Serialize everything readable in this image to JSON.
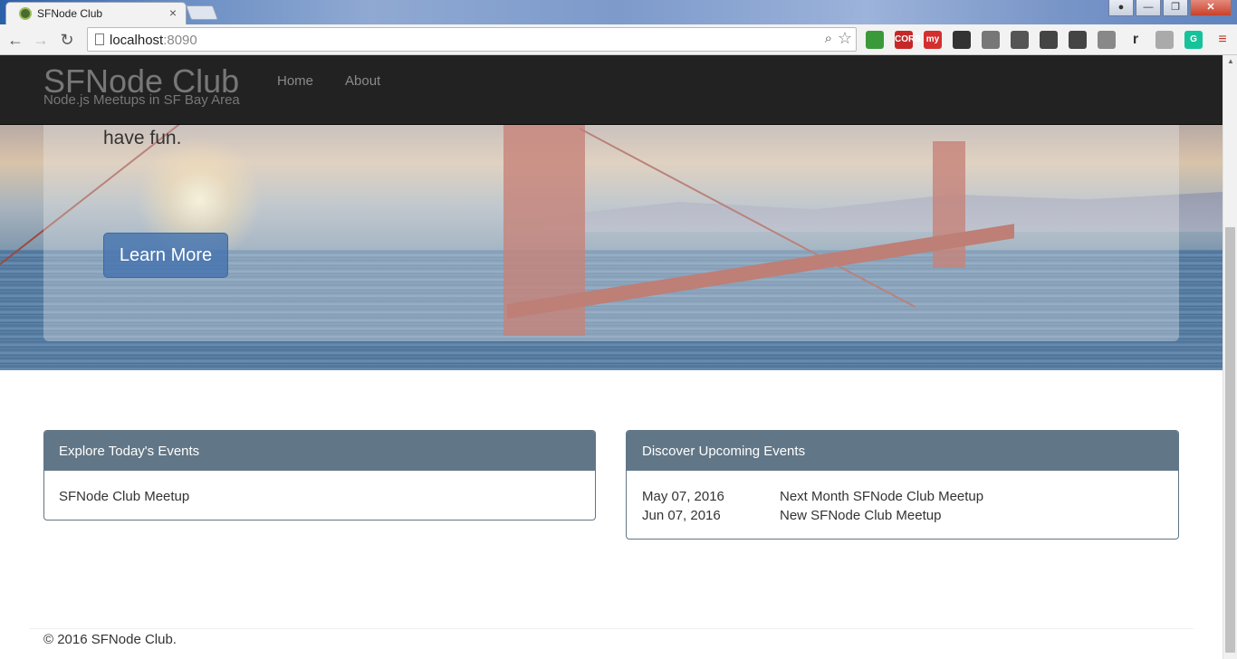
{
  "browser": {
    "tab_title": "SFNode Club",
    "tab_close": "×",
    "url_host": "localhost",
    "url_port": ":8090",
    "win_minimize": "—",
    "win_maximize": "❐",
    "win_close": "✕",
    "extensions": [
      {
        "name": "green-leaf-extension",
        "label": "",
        "color": "#3a9a3a"
      },
      {
        "name": "cors-extension",
        "label": "CORS",
        "color": "#c62828"
      },
      {
        "name": "my-extension",
        "label": "my",
        "color": "#d32f2f"
      },
      {
        "name": "owl-extension",
        "label": "",
        "color": "#333333"
      },
      {
        "name": "cast-extension",
        "label": "",
        "color": "#777777"
      },
      {
        "name": "picture-extension",
        "label": "",
        "color": "#555555"
      },
      {
        "name": "compass-extension",
        "label": "",
        "color": "#444444"
      },
      {
        "name": "evernote-extension",
        "label": "",
        "color": "#444444"
      },
      {
        "name": "copy-extension",
        "label": "",
        "color": "#888888"
      },
      {
        "name": "r-extension",
        "label": "r",
        "color": "#f2f2f2"
      },
      {
        "name": "notes-extension",
        "label": "",
        "color": "#aaaaaa"
      },
      {
        "name": "grammarly-extension",
        "label": "G",
        "color": "#15c39a"
      },
      {
        "name": "menu-extension",
        "label": "≡",
        "color": "#f2f2f2"
      }
    ]
  },
  "navbar": {
    "brand": "SFNode Club",
    "tagline": "Node.js Meetups in SF Bay Area",
    "links": [
      "Home",
      "About"
    ]
  },
  "hero": {
    "text": "have fun.",
    "button": "Learn More"
  },
  "today": {
    "heading": "Explore Today's Events",
    "events": [
      "SFNode Club Meetup"
    ]
  },
  "upcoming": {
    "heading": "Discover Upcoming Events",
    "events": [
      {
        "date": "May 07, 2016",
        "name": "Next Month SFNode Club Meetup"
      },
      {
        "date": "Jun 07, 2016",
        "name": "New SFNode Club Meetup"
      }
    ]
  },
  "footer": "© 2016 SFNode Club."
}
